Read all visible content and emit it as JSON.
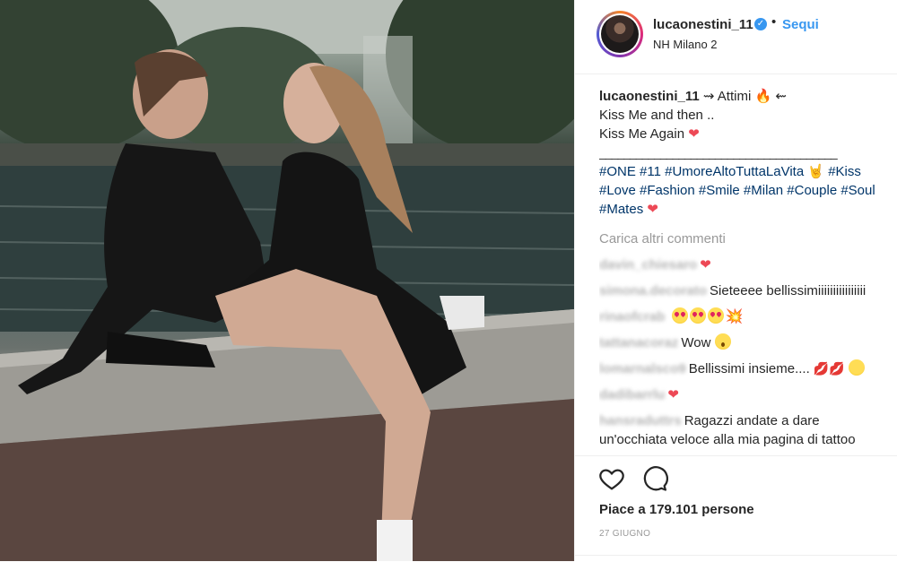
{
  "post": {
    "author": "lucaonestini_11",
    "follow_label": "Sequi",
    "dot": "•",
    "location": "NH Milano 2",
    "caption": {
      "username": "lucaonestini_11",
      "line1": " ⇝ Attimi",
      "line1_end": " ⇜",
      "line2": "Kiss Me and then ..",
      "line3": "Kiss Me Again",
      "rule": "_______________________________________",
      "hashtags": "#ONE #11 #UmoreAltoTuttaLaVita",
      "hashtags2": " #Kiss #Love #Fashion #Smile #Milan #Couple #Soul #Mates"
    },
    "load_more": "Carica altri commenti",
    "comments": [
      {
        "user": "davin_chiesaro",
        "text": ""
      },
      {
        "user": "simona.decorato",
        "text": "Sieteeee bellissimiiiiiiiiiiiiiiii"
      },
      {
        "user": "rinaofcrab",
        "text": ""
      },
      {
        "user": "tattanacoraz",
        "text": "Wow"
      },
      {
        "user": "lomarnalsco9",
        "text": "Bellissimi insieme...."
      },
      {
        "user": "dadibarrlu",
        "text": ""
      },
      {
        "user": "hansraduttrs",
        "text": "Ragazzi andate a dare un'occhiata veloce alla mia pagina di tattoo"
      }
    ],
    "likes": "Piace a 179.101 persone",
    "date": "27 GIUGNO"
  },
  "icons": {
    "verified": "verified-badge-icon",
    "like": "heart-outline-icon",
    "comment": "comment-bubble-icon"
  },
  "colors": {
    "link": "#3897f0",
    "hashtag": "#003569",
    "heart": "#ed4956"
  }
}
